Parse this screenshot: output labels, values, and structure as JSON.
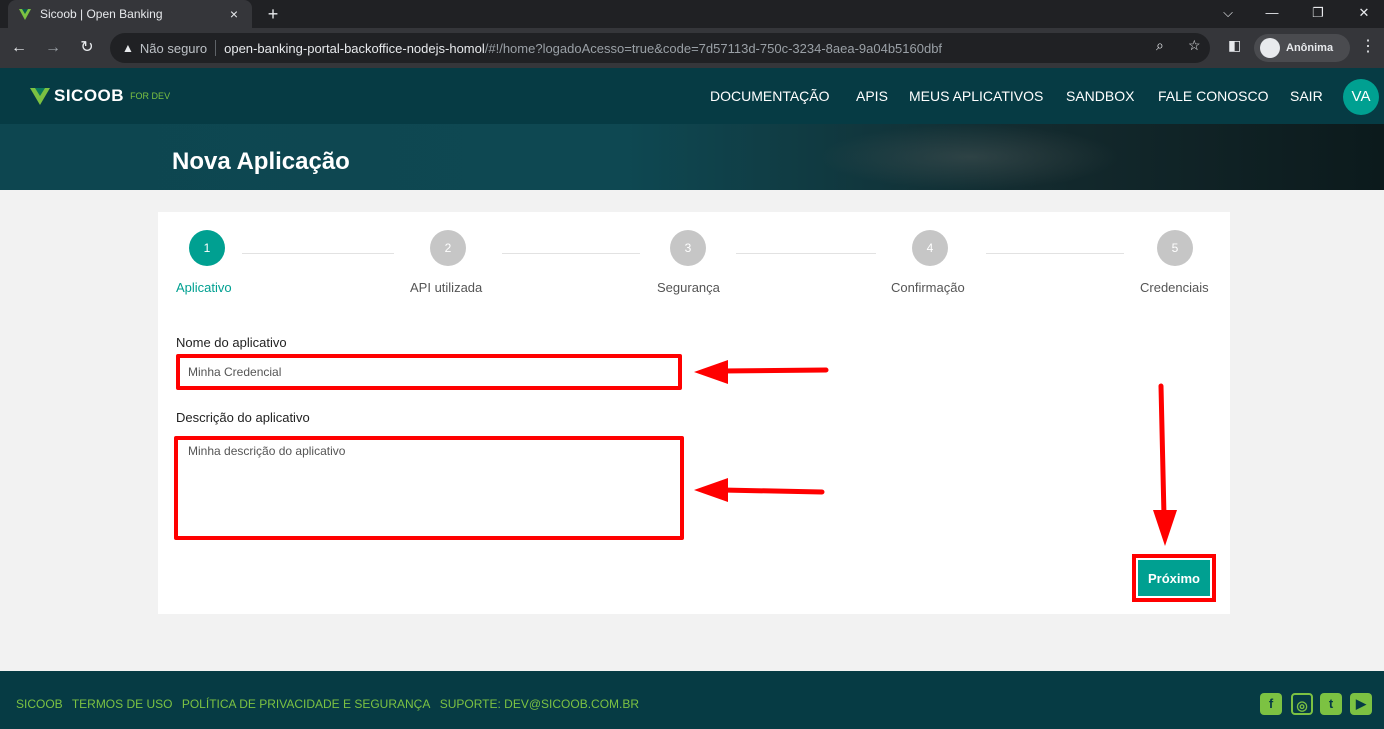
{
  "browser": {
    "tab_title": "Sicoob | Open Banking",
    "tab_close": "×",
    "new_tab": "+",
    "security_label": "Não seguro",
    "url_host": "open-banking-portal-backoffice-nodejs-homol",
    "url_path": "/#!/home?logadoAcesso=true&code=7d57113d-750c-3234-8aea-9a04b5160dbf",
    "profile_label": "Anônima"
  },
  "header": {
    "logo_text": "SICOOB",
    "logo_sub": "FOR DEV",
    "nav": [
      "DOCUMENTAÇÃO",
      "APIS",
      "MEUS APLICATIVOS",
      "SANDBOX",
      "FALE CONOSCO",
      "SAIR"
    ],
    "avatar": "VA"
  },
  "hero": {
    "title": "Nova Aplicação"
  },
  "stepper": {
    "steps": [
      {
        "number": "1",
        "label": "Aplicativo"
      },
      {
        "number": "2",
        "label": "API utilizada"
      },
      {
        "number": "3",
        "label": "Segurança"
      },
      {
        "number": "4",
        "label": "Confirmação"
      },
      {
        "number": "5",
        "label": "Credenciais"
      }
    ],
    "active_step": 1
  },
  "form": {
    "name_label": "Nome do aplicativo",
    "name_value": "Minha Credencial",
    "description_label": "Descrição do aplicativo",
    "description_value": "Minha descrição do aplicativo",
    "next_button": "Próximo"
  },
  "footer": {
    "links": [
      "SICOOB",
      "TERMOS DE USO",
      "POLÍTICA DE PRIVACIDADE E SEGURANÇA",
      "SUPORTE: DEV@SICOOB.COM.BR"
    ],
    "social": [
      "facebook-icon",
      "instagram-icon",
      "twitter-icon",
      "youtube-icon"
    ]
  },
  "colors": {
    "brand_dark": "#063b44",
    "accent": "#00a091",
    "brand_green": "#7cc242",
    "highlight": "#ff0000"
  }
}
